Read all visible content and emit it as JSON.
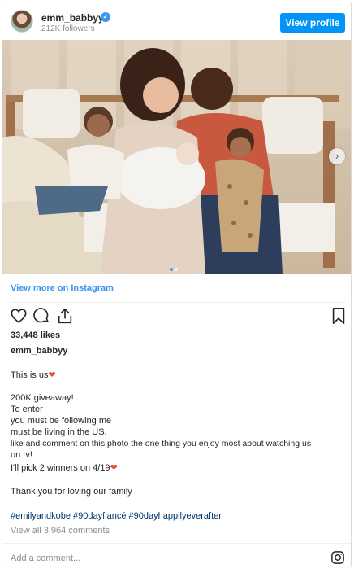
{
  "header": {
    "username": "emm_babbyy",
    "verified_glyph": "✓",
    "followers": "212K followers",
    "view_profile_label": "View profile"
  },
  "photo": {
    "description_icon": "family-photo",
    "next_glyph": "›",
    "carousel_dots": 2,
    "active_dot": 0
  },
  "view_more_label": "View more on Instagram",
  "actions": {
    "icons": [
      "heart-icon",
      "comment-icon",
      "share-icon",
      "bookmark-icon"
    ]
  },
  "likes": "33,448 likes",
  "owner": "emm_babbyy",
  "caption": {
    "line1": "This is us",
    "line2": "200K giveaway!",
    "line3": "To enter",
    "line4": "you must be following me",
    "line5": "must be living in the US.",
    "line6": "like and comment on this photo the one thing you enjoy most about watching us",
    "line7": "on tv!",
    "line8": "I'll pick 2 winners on 4/19",
    "line9": "Thank you for loving our family",
    "heart_emoji": "❤"
  },
  "hashtags": "#emilyandkobe #90dayfiancé #90dayhappilyeverafter",
  "view_all_comments": "View all 3,964 comments",
  "comment_placeholder": "Add a comment...",
  "colors": {
    "accent": "#0095f6",
    "link": "#3897f0",
    "hashtag": "#00376b",
    "muted": "#8e8e8e",
    "heart_emoji": "#e4522e"
  }
}
